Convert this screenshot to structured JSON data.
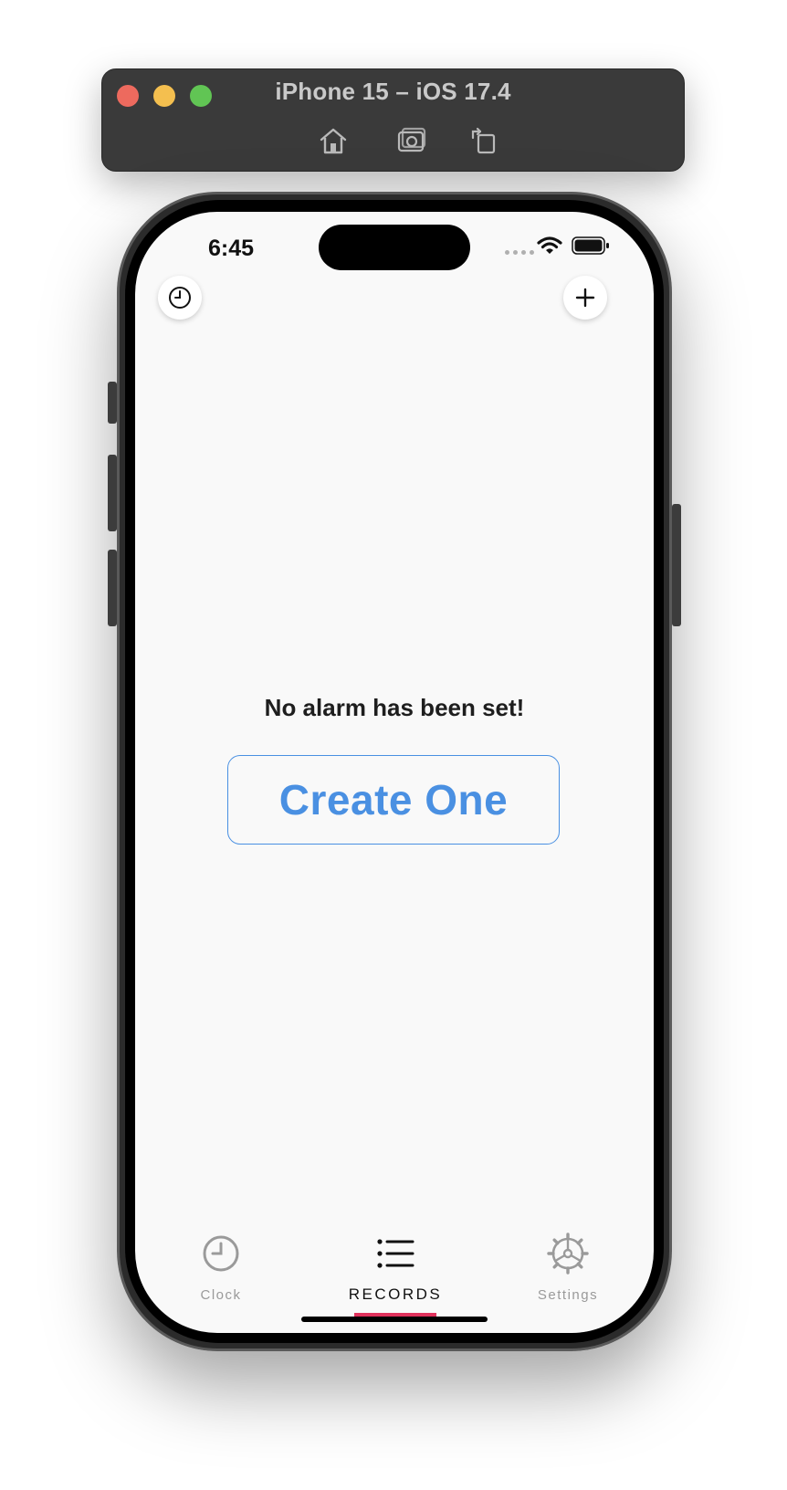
{
  "window": {
    "title": "iPhone 15 – iOS 17.4",
    "toolbar": [
      "home-icon",
      "screenshot-icon",
      "rotate-icon"
    ]
  },
  "status_bar": {
    "time": "6:45",
    "icons": [
      "signal-dots-icon",
      "wifi-icon",
      "battery-icon"
    ]
  },
  "header": {
    "left_button_icon": "clock-icon",
    "right_button_icon": "plus-icon"
  },
  "main": {
    "empty_message": "No alarm has been set!",
    "create_button_label": "Create One"
  },
  "tab_bar": {
    "items": [
      {
        "label": "Clock",
        "icon": "clock-icon",
        "active": false
      },
      {
        "label": "RECORDS",
        "icon": "list-icon",
        "active": true
      },
      {
        "label": "Settings",
        "icon": "gear-icon",
        "active": false
      }
    ]
  },
  "colors": {
    "accent": "#4a90e2",
    "tab_indicator": "#e0315c",
    "screen_bg": "#f9f9f9",
    "window_bar": "#3a3a3a"
  }
}
